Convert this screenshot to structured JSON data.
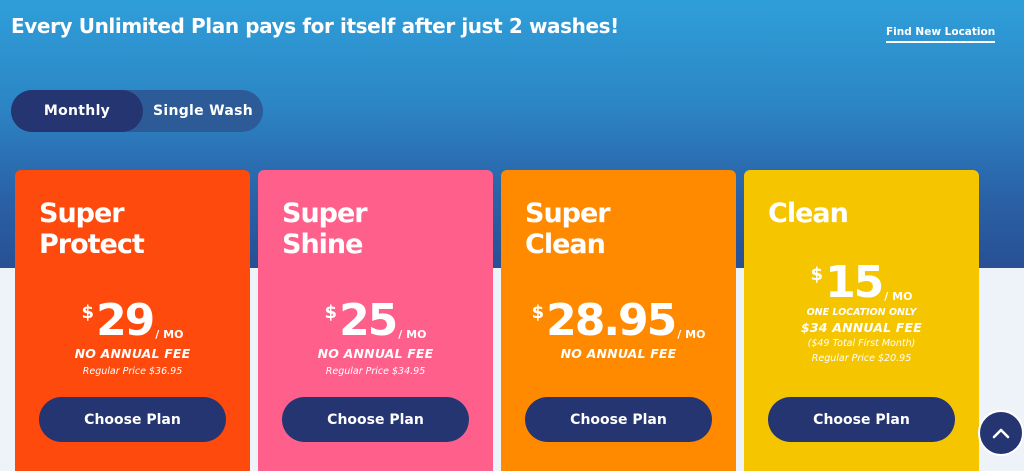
{
  "header": {
    "headline": "Every Unlimited Plan pays for itself after just 2 washes!",
    "find_location": "Find New Location"
  },
  "toggle": {
    "monthly": "Monthly",
    "single": "Single Wash",
    "selected": "Monthly"
  },
  "plans": [
    {
      "name_line1": "Super",
      "name_line2": "Protect",
      "currency": "$",
      "price": "29",
      "per": "/ MO",
      "fee": "NO ANNUAL FEE",
      "regular": "Regular Price $36.95",
      "button": "Choose Plan",
      "color": "#ff4a0d"
    },
    {
      "name_line1": "Super",
      "name_line2": "Shine",
      "currency": "$",
      "price": "25",
      "per": "/ MO",
      "fee": "NO ANNUAL FEE",
      "regular": "Regular Price $34.95",
      "button": "Choose Plan",
      "color": "#ff5f8b"
    },
    {
      "name_line1": "Super",
      "name_line2": "Clean",
      "currency": "$",
      "price": "28.95",
      "per": "/ MO",
      "fee": "NO ANNUAL FEE",
      "regular": "",
      "button": "Choose Plan",
      "color": "#ff8a00"
    },
    {
      "name_line1": "Clean",
      "name_line2": "",
      "currency": "$",
      "price": "15",
      "per": "/ MO",
      "location_note": "ONE LOCATION ONLY",
      "fee": "$34 ANNUAL FEE",
      "first_month": "($49 Total First Month)",
      "regular": "Regular Price $20.95",
      "button": "Choose Plan",
      "color": "#f5c500"
    }
  ],
  "scroll_top_icon": "chevron-up-icon",
  "colors": {
    "navy": "#243572",
    "hero_top": "#2f9fd9",
    "hero_bottom": "#284f94"
  }
}
